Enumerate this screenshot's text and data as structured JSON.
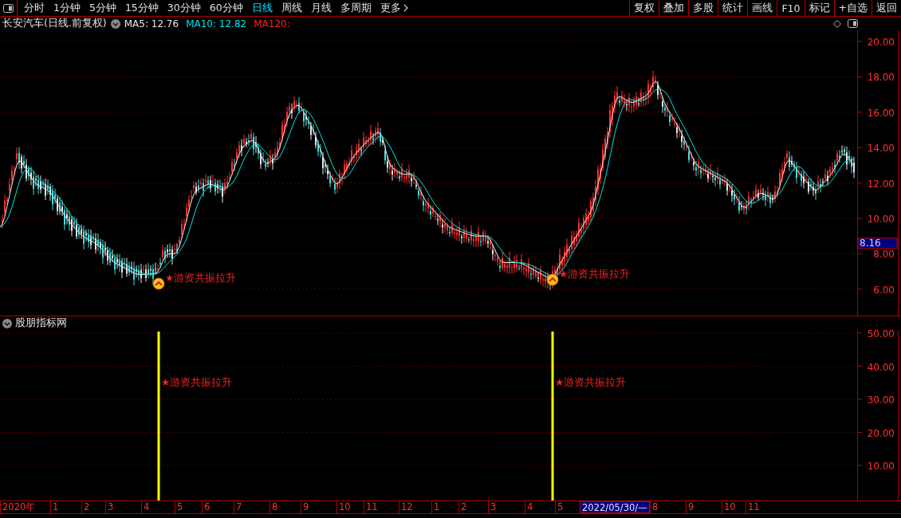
{
  "toolbar": {
    "periods": [
      {
        "label": "分时",
        "selected": false
      },
      {
        "label": "1分钟",
        "selected": false
      },
      {
        "label": "5分钟",
        "selected": false
      },
      {
        "label": "15分钟",
        "selected": false
      },
      {
        "label": "30分钟",
        "selected": false
      },
      {
        "label": "60分钟",
        "selected": false
      },
      {
        "label": "日线",
        "selected": true
      },
      {
        "label": "周线",
        "selected": false
      },
      {
        "label": "月线",
        "selected": false
      },
      {
        "label": "多周期",
        "selected": false
      }
    ],
    "more": "更多",
    "actions": [
      "复权",
      "叠加",
      "多股",
      "统计",
      "画线",
      "F10",
      "标记",
      "+自选",
      "返回"
    ]
  },
  "main_chart": {
    "title": "长安汽车(日线.前复权)",
    "ma": [
      {
        "label": "MA5: 12.76",
        "color": "#e8e8e8"
      },
      {
        "label": "MA10: 12.82",
        "color": "#00e5e5"
      },
      {
        "label": "MA120:",
        "color": "#ff2020"
      }
    ],
    "y_ticks": [
      "20.00",
      "18.00",
      "16.00",
      "14.00",
      "12.00",
      "10.00",
      "8.00",
      "6.00"
    ],
    "price_tag": "8.16",
    "signals": [
      {
        "label": "★游资共振拉升"
      },
      {
        "label": "★游资共振拉升"
      }
    ]
  },
  "indicator": {
    "title": "股朋指标网",
    "y_ticks": [
      "50.00",
      "40.00",
      "30.00",
      "20.00",
      "10.00"
    ],
    "signals": [
      {
        "label": "★游资共振拉升"
      },
      {
        "label": "★游资共振拉升"
      }
    ]
  },
  "date_axis": [
    {
      "label": "2020年",
      "kind": "month"
    },
    {
      "label": "1",
      "kind": "month"
    },
    {
      "label": "2",
      "kind": "month"
    },
    {
      "label": "3",
      "kind": "month"
    },
    {
      "label": "4",
      "kind": "month"
    },
    {
      "label": "5",
      "kind": "month"
    },
    {
      "label": "6",
      "kind": "month"
    },
    {
      "label": "7",
      "kind": "month"
    },
    {
      "label": "8",
      "kind": "month"
    },
    {
      "label": "9",
      "kind": "month"
    },
    {
      "label": "10",
      "kind": "month"
    },
    {
      "label": "11",
      "kind": "month"
    },
    {
      "label": "12",
      "kind": "month"
    },
    {
      "label": "1",
      "kind": "month"
    },
    {
      "label": "2",
      "kind": "month"
    },
    {
      "label": "3",
      "kind": "month"
    },
    {
      "label": "4",
      "kind": "month"
    },
    {
      "label": "5",
      "kind": "month"
    },
    {
      "label": "2022/05/30/—",
      "kind": "cursor"
    },
    {
      "label": "8",
      "kind": "month"
    },
    {
      "label": "9",
      "kind": "month"
    },
    {
      "label": "10",
      "kind": "month"
    },
    {
      "label": "11",
      "kind": "month"
    }
  ]
}
